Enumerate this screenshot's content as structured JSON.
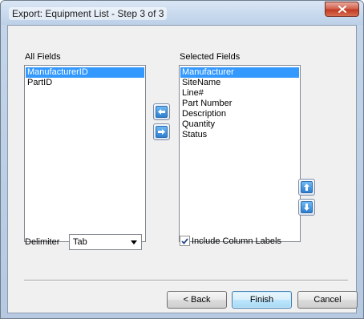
{
  "window": {
    "title": "Export: Equipment List - Step 3 of 3"
  },
  "all_fields": {
    "label": "All Fields",
    "items": [
      {
        "label": "ManufacturerID",
        "selected": true
      },
      {
        "label": "PartID",
        "selected": false
      }
    ]
  },
  "selected_fields": {
    "label": "Selected Fields",
    "items": [
      {
        "label": "Manufacturer",
        "selected": true
      },
      {
        "label": "SiteName",
        "selected": false
      },
      {
        "label": "Line#",
        "selected": false
      },
      {
        "label": "Part Number",
        "selected": false
      },
      {
        "label": "Description",
        "selected": false
      },
      {
        "label": "Quantity",
        "selected": false
      },
      {
        "label": "Status",
        "selected": false
      }
    ]
  },
  "icons": {
    "move_left": "arrow-left-icon",
    "move_right": "arrow-right-icon",
    "move_up": "arrow-up-icon",
    "move_down": "arrow-down-icon",
    "close": "close-icon",
    "check": "checkmark-icon"
  },
  "delimiter": {
    "label": "Delimiter",
    "value": "Tab"
  },
  "include_labels": {
    "label": "Include Column Labels",
    "checked": true
  },
  "buttons": {
    "back": "< Back",
    "finish": "Finish",
    "cancel": "Cancel"
  },
  "colors": {
    "selection": "#3399ff",
    "accent_arrow": "#2f7fd0",
    "close_button": "#c23a23"
  }
}
